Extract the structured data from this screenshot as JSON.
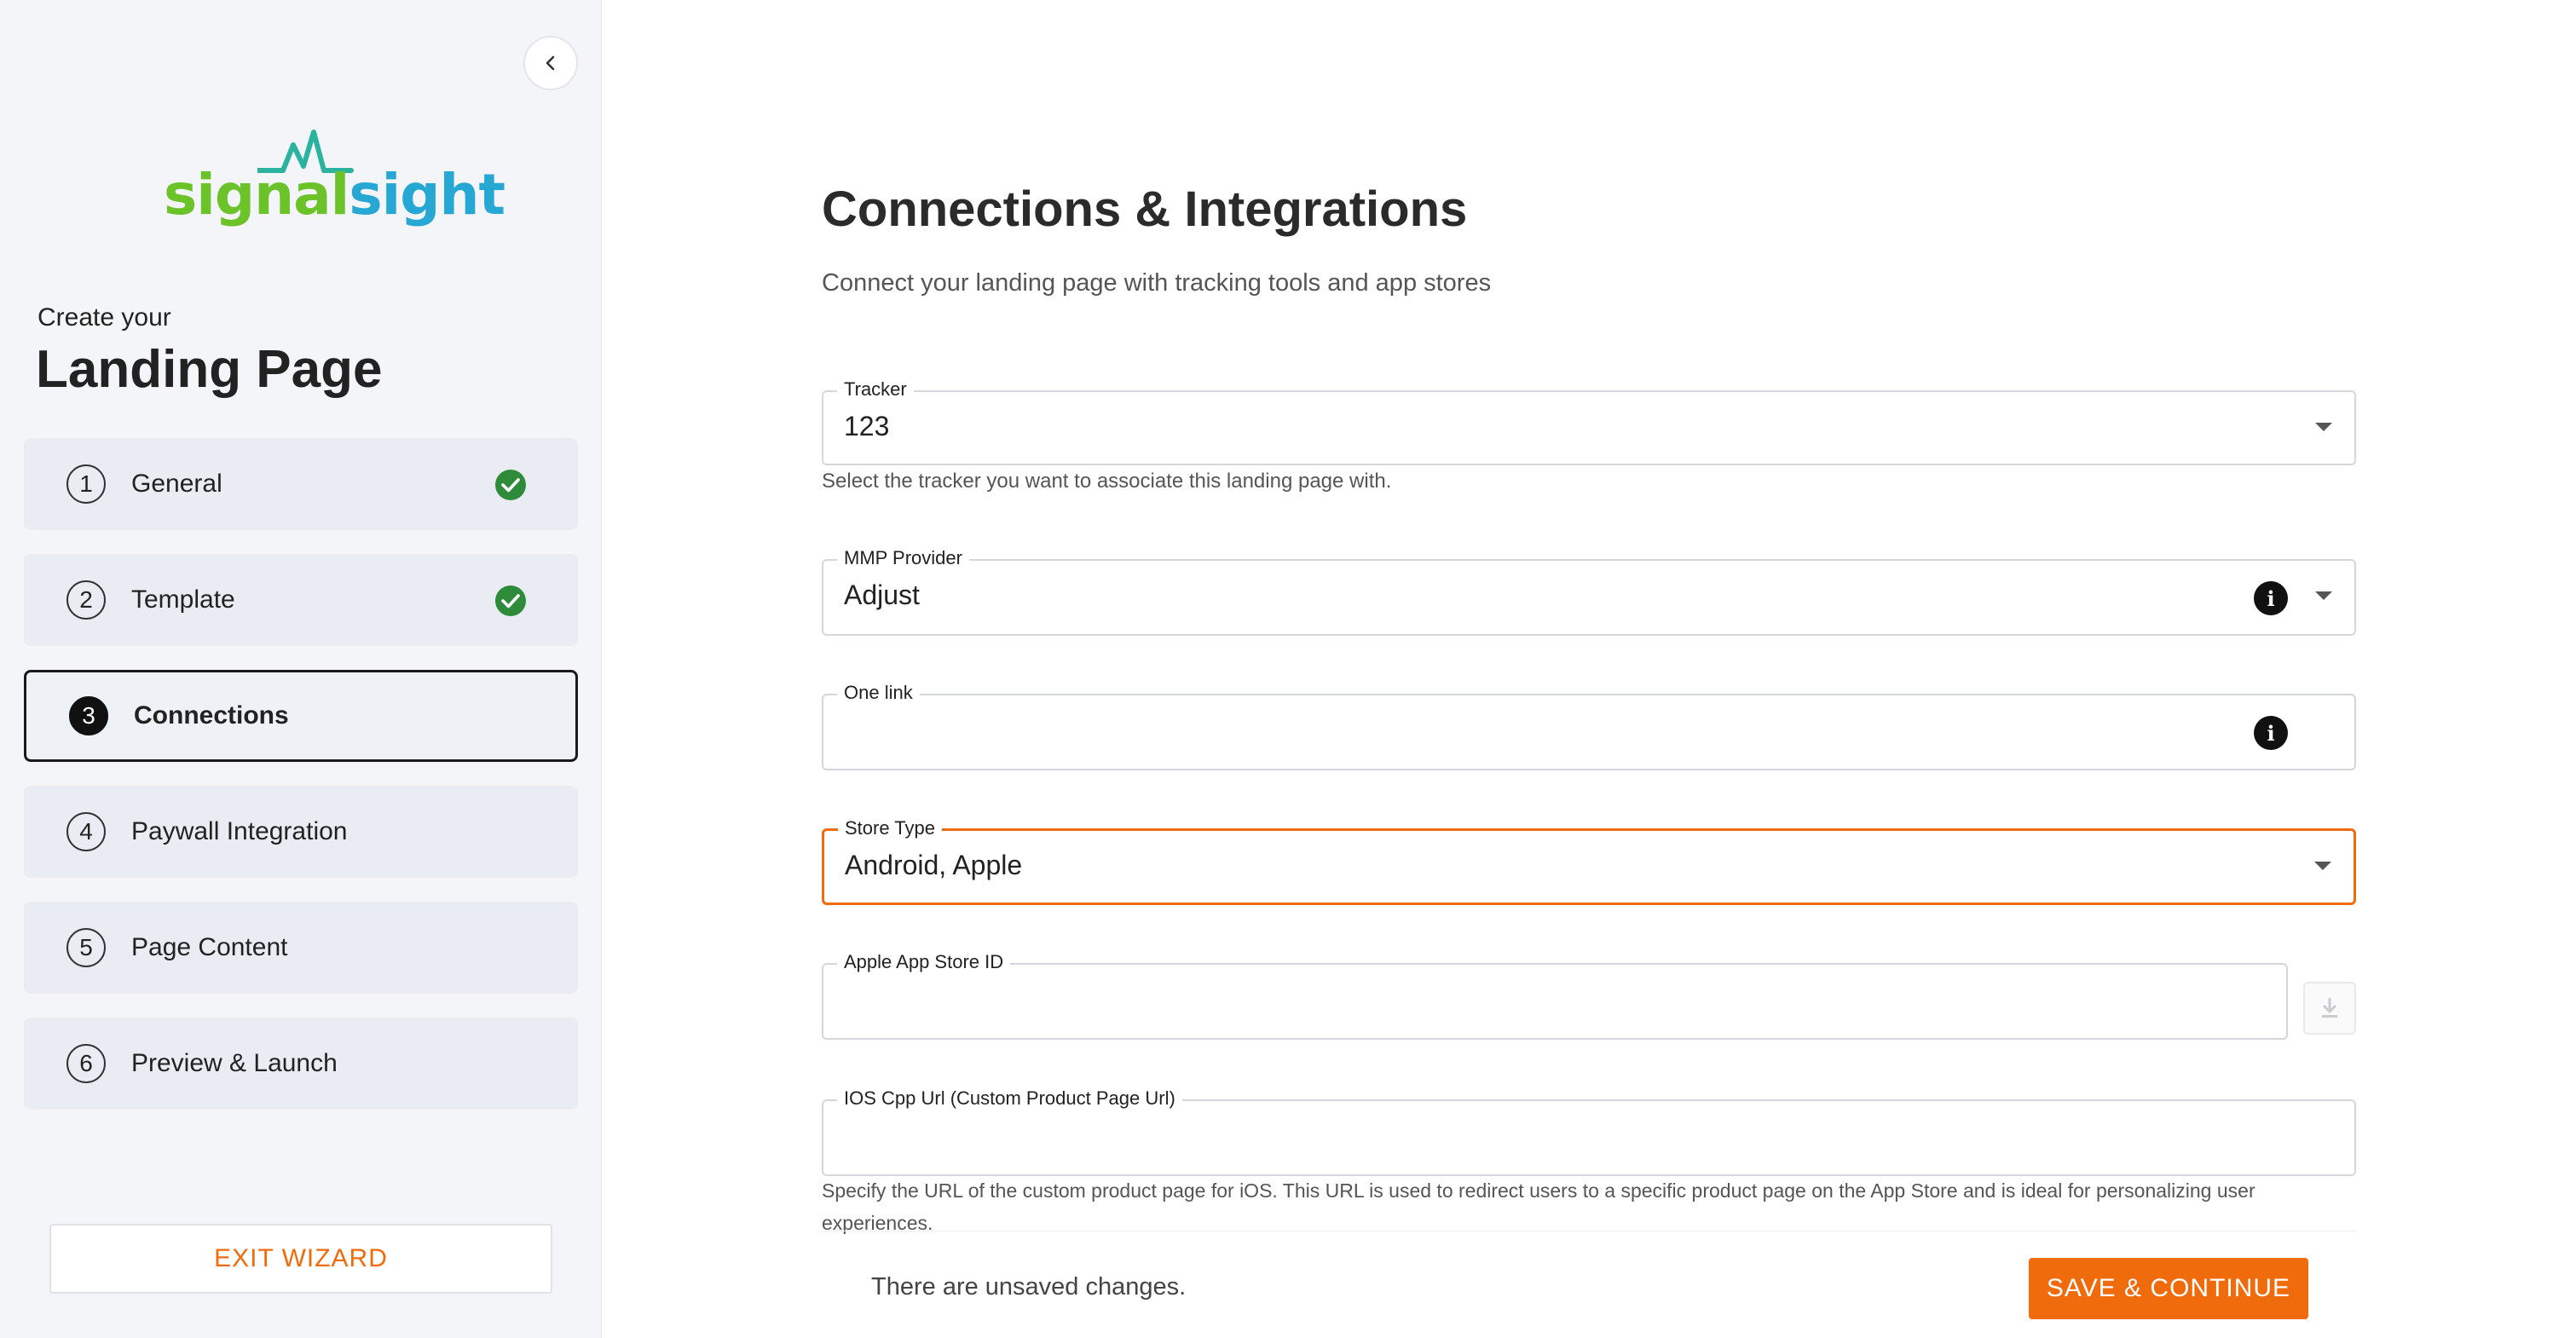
{
  "brand": {
    "logo_part1": "signal",
    "logo_part2": "sight",
    "green": "#6cc229",
    "blue": "#26a7d4"
  },
  "sidebar": {
    "create_sub": "Create your",
    "create_title": "Landing Page",
    "steps": [
      {
        "num": "1",
        "label": "General",
        "completed": true,
        "active": false
      },
      {
        "num": "2",
        "label": "Template",
        "completed": true,
        "active": false
      },
      {
        "num": "3",
        "label": "Connections",
        "completed": false,
        "active": true
      },
      {
        "num": "4",
        "label": "Paywall Integration",
        "completed": false,
        "active": false
      },
      {
        "num": "5",
        "label": "Page Content",
        "completed": false,
        "active": false
      },
      {
        "num": "6",
        "label": "Preview & Launch",
        "completed": false,
        "active": false
      }
    ],
    "exit_label": "EXIT WIZARD"
  },
  "main": {
    "title": "Connections & Integrations",
    "description": "Connect your landing page with tracking tools and app stores",
    "tracker": {
      "label": "Tracker",
      "value": "123",
      "helper": "Select the tracker you want to associate this landing page with."
    },
    "mmp": {
      "label": "MMP Provider",
      "value": "Adjust"
    },
    "onelink": {
      "label": "One link",
      "value": ""
    },
    "store_type": {
      "label": "Store Type",
      "value": "Android, Apple"
    },
    "apple_id": {
      "label": "Apple App Store ID",
      "value": ""
    },
    "ios_cpp": {
      "label": "IOS Cpp Url (Custom Product Page Url)",
      "value": "",
      "helper": "Specify the URL of the custom product page for iOS. This URL is used to redirect users to a specific product page on the App Store and is ideal for personalizing user experiences."
    },
    "unsaved": "There are unsaved changes.",
    "save_label": "SAVE & CONTINUE"
  },
  "colors": {
    "accent": "#ef6b0c",
    "check": "#2e8b3a"
  }
}
